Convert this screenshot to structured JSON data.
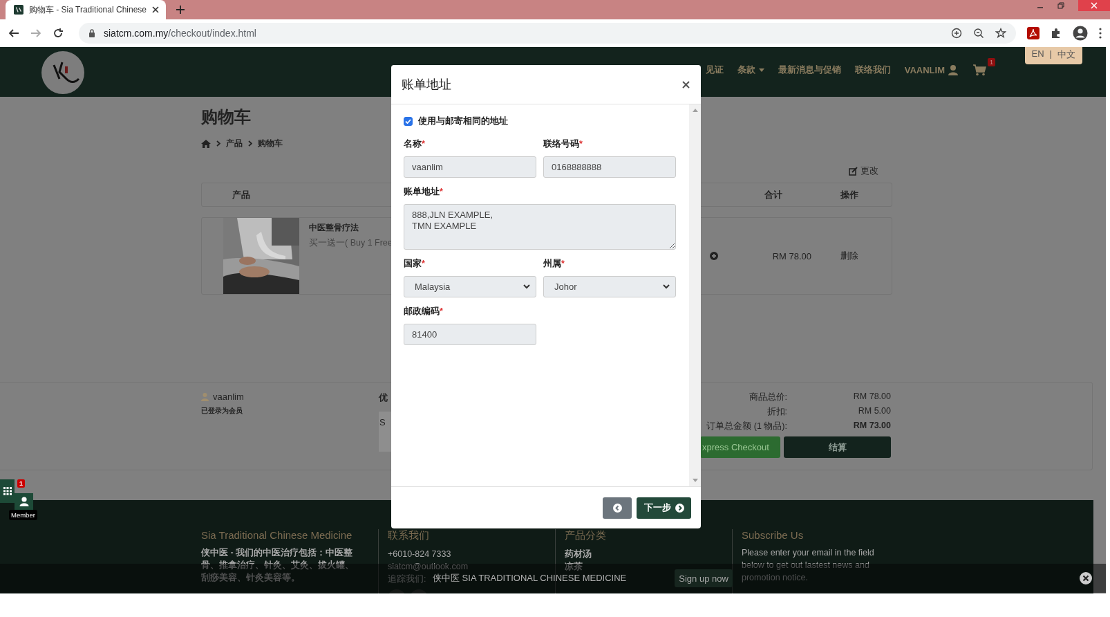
{
  "browser": {
    "tab_title": "购物车 - Sia Traditional Chinese",
    "url_host": "siatcm.com.my",
    "url_path": "/checkout/index.html"
  },
  "site_nav": {
    "items": [
      {
        "label": "见证",
        "kind": "link"
      },
      {
        "label": "条款",
        "kind": "dropdown"
      },
      {
        "label": "最新消息与促销",
        "kind": "link"
      },
      {
        "label": "联络我们",
        "kind": "link"
      },
      {
        "label": "VAANLIM",
        "kind": "user"
      }
    ],
    "cart_count": "1",
    "languages": [
      "EN",
      "中文"
    ],
    "language_separator": "|"
  },
  "page": {
    "title": "购物车",
    "breadcrumb": [
      "产品",
      "购物车"
    ],
    "edit_link": "更改"
  },
  "cart_table": {
    "columns": [
      "产品",
      "合计",
      "操作"
    ],
    "rows": [
      {
        "name": "中医整骨疗法",
        "subtitle": "买一送一( Buy 1 Free",
        "total": "RM 78.00",
        "action": "删除"
      }
    ]
  },
  "summary": {
    "user": "vaanlim",
    "user_status": "已登录为会员",
    "coupon_label": "优",
    "coupon_text": "S",
    "lines": [
      {
        "label": "商品总价:",
        "value": "RM 78.00",
        "bold": false
      },
      {
        "label": "折扣:",
        "value": "RM 5.00",
        "bold": false
      },
      {
        "label": "订单总金额 (1 物品):",
        "value": "RM 73.00",
        "bold": true
      }
    ],
    "buttons": [
      {
        "label": "xpress Checkout",
        "kind": "express"
      },
      {
        "label": "结算",
        "kind": "checkout"
      }
    ]
  },
  "footer": {
    "columns": [
      {
        "heading": "Sia Traditional Chinese Medicine",
        "kind": "paragraph",
        "lines": [
          "侠中医 - 我们的中医治疗包括：中医整骨、推拿治疗、针灸、艾灸、拔火罐、刮痧美容、针灸美容等。"
        ]
      },
      {
        "heading": "联系我们",
        "kind": "contact",
        "lines": [
          "+6010-824 7333",
          "siatcm@outlook.com",
          "追踪我们:"
        ]
      },
      {
        "heading": "产品分类",
        "kind": "list",
        "lines": [
          "药材汤",
          "凉茶"
        ]
      },
      {
        "heading": "Subscribe Us",
        "kind": "paragraph",
        "lines": [
          "Please enter your email in the field below to get out lastest news and promotion notice."
        ]
      }
    ]
  },
  "notice_bar": {
    "text": "侠中医 SIA TRADITIONAL CHINESE MEDICINE",
    "button": "Sign up now"
  },
  "side_widget": {
    "badge": "1",
    "tooltip": "Member"
  },
  "modal": {
    "title": "账单地址",
    "same_address": {
      "label": "使用与邮寄相同的地址",
      "checked": true
    },
    "fields": [
      {
        "label": "名称",
        "required_mark": "*",
        "kind": "input",
        "value": "vaanlim",
        "disabled": true
      },
      {
        "label": "联络号码",
        "required_mark": "*",
        "kind": "input",
        "value": "0168888888",
        "disabled": true
      },
      {
        "label": "账单地址",
        "required_mark": "*",
        "kind": "textarea",
        "value": "888,JLN EXAMPLE,\nTMN EXAMPLE",
        "disabled": true
      },
      {
        "label": "国家",
        "required_mark": "*",
        "kind": "select",
        "value": "Malaysia",
        "disabled": true
      },
      {
        "label": "州属",
        "required_mark": "*",
        "kind": "select",
        "value": "Johor",
        "disabled": true
      },
      {
        "label": "邮政编码",
        "required_mark": "*",
        "kind": "input",
        "value": "81400",
        "disabled": true
      }
    ],
    "buttons": [
      {
        "kind": "back"
      },
      {
        "kind": "next",
        "label": "下一步"
      }
    ]
  }
}
